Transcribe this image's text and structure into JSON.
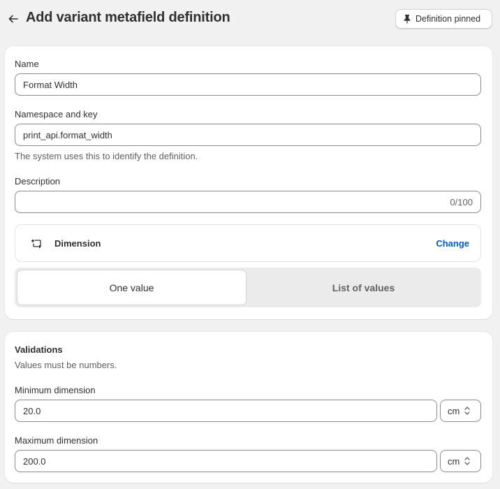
{
  "header": {
    "title": "Add variant metafield definition",
    "pin_label": "Definition pinned"
  },
  "form": {
    "name_label": "Name",
    "name_value": "Format Width",
    "namespace_label": "Namespace and key",
    "namespace_value": "print_api.format_width",
    "namespace_help": "The system uses this to identify the definition.",
    "description_label": "Description",
    "description_value": "",
    "description_counter": "0/100"
  },
  "type": {
    "icon": "dimension-icon",
    "name": "Dimension",
    "change_label": "Change"
  },
  "value_mode": {
    "options": [
      "One value",
      "List of values"
    ],
    "selected": "One value"
  },
  "validations": {
    "title": "Validations",
    "subtitle": "Values must be numbers.",
    "min_label": "Minimum dimension",
    "min_value": "20.0",
    "min_unit": "cm",
    "max_label": "Maximum dimension",
    "max_value": "200.0",
    "max_unit": "cm"
  },
  "colors": {
    "link": "#005bd3",
    "background": "#f1f1f1"
  }
}
